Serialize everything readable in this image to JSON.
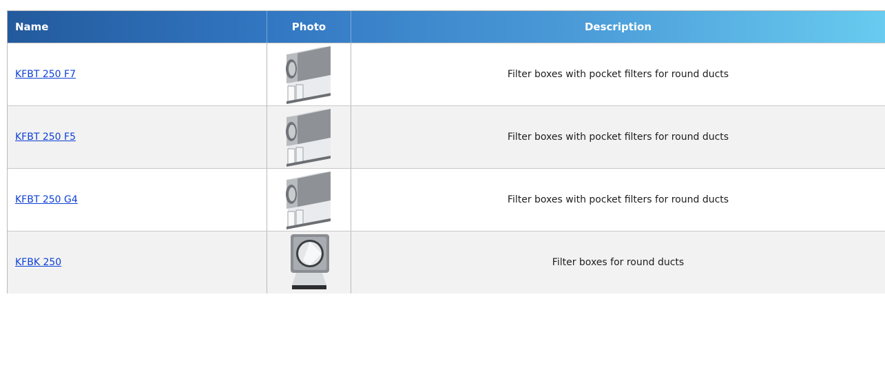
{
  "table": {
    "headers": {
      "name": "Name",
      "photo": "Photo",
      "description": "Description"
    },
    "rows": [
      {
        "name": "KFBT 250 F7",
        "photo_icon": "pocket-filter-box-icon",
        "description": "Filter boxes with pocket filters for round ducts"
      },
      {
        "name": "KFBT 250 F5",
        "photo_icon": "pocket-filter-box-icon",
        "description": "Filter boxes with pocket filters for round ducts"
      },
      {
        "name": "KFBT 250 G4",
        "photo_icon": "pocket-filter-box-icon",
        "description": "Filter boxes with pocket filters for round ducts"
      },
      {
        "name": "KFBK 250",
        "photo_icon": "cassette-filter-box-icon",
        "description": "Filter boxes for round ducts"
      }
    ]
  },
  "colors": {
    "header_start": "#235a9d",
    "header_end": "#68cbef",
    "link": "#0b3fd6",
    "row_alt": "#f2f2f2"
  }
}
